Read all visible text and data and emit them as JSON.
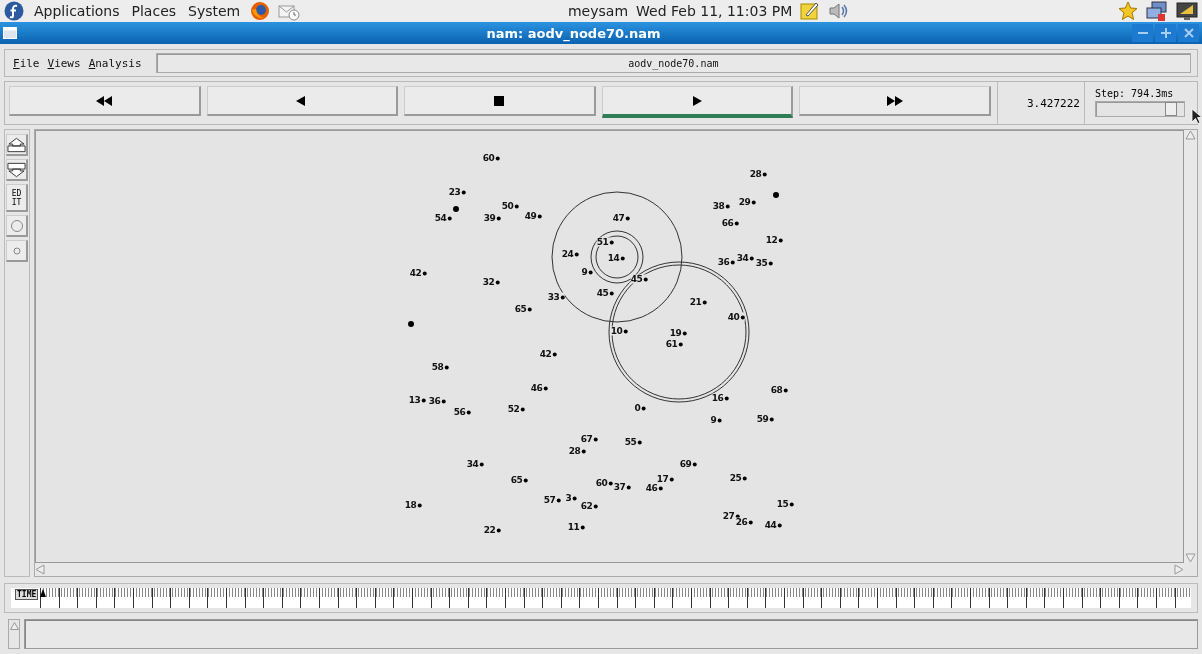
{
  "top_panel": {
    "menus": [
      "Applications",
      "Places",
      "System"
    ],
    "user": "meysam",
    "clock": "Wed Feb 11, 11:03 PM"
  },
  "window": {
    "title": "nam: aodv_node70.nam"
  },
  "menu_bar": {
    "items": [
      "File",
      "Views",
      "Analysis"
    ],
    "file_name": "aodv_node70.nam"
  },
  "playback": {
    "buttons": [
      {
        "kind": "rewind",
        "selected": false
      },
      {
        "kind": "back",
        "selected": false
      },
      {
        "kind": "stop",
        "selected": false
      },
      {
        "kind": "play",
        "selected": true
      },
      {
        "kind": "forward",
        "selected": false
      }
    ],
    "time": "3.427222",
    "step": {
      "label": "Step: 794.3ms",
      "level": 0.85
    }
  },
  "tools": [
    {
      "kind": "zoom-in"
    },
    {
      "kind": "zoom-out"
    },
    {
      "kind": "edit",
      "lines": [
        "ED",
        "IT"
      ]
    },
    {
      "kind": "large-circle"
    },
    {
      "kind": "small-circle"
    }
  ],
  "nodes": [
    {
      "kind": "labeled",
      "label": "60"
    },
    {
      "kind": "labeled",
      "label": "28"
    },
    {
      "kind": "labeled",
      "label": "23"
    },
    {
      "kind": "dot"
    },
    {
      "kind": "dot"
    },
    {
      "kind": "labeled",
      "label": "50"
    },
    {
      "kind": "labeled",
      "label": "38"
    },
    {
      "kind": "labeled",
      "label": "29"
    },
    {
      "kind": "labeled",
      "label": "54"
    },
    {
      "kind": "labeled",
      "label": "39"
    },
    {
      "kind": "labeled",
      "label": "49"
    },
    {
      "kind": "labeled",
      "label": "47"
    },
    {
      "kind": "labeled",
      "label": "66"
    },
    {
      "kind": "labeled",
      "label": "51"
    },
    {
      "kind": "labeled",
      "label": "12"
    },
    {
      "kind": "labeled",
      "label": "24"
    },
    {
      "kind": "labeled",
      "label": "14"
    },
    {
      "kind": "labeled",
      "label": "36"
    },
    {
      "kind": "labeled",
      "label": "34"
    },
    {
      "kind": "labeled",
      "label": "35"
    },
    {
      "kind": "labeled",
      "label": "42"
    },
    {
      "kind": "labeled",
      "label": "9"
    },
    {
      "kind": "labeled",
      "label": "32"
    },
    {
      "kind": "labeled",
      "label": "45"
    },
    {
      "kind": "labeled",
      "label": "33"
    },
    {
      "kind": "labeled",
      "label": "45"
    },
    {
      "kind": "labeled",
      "label": "65"
    },
    {
      "kind": "labeled",
      "label": "21"
    },
    {
      "kind": "labeled",
      "label": "40"
    },
    {
      "kind": "dot"
    },
    {
      "kind": "labeled",
      "label": "10"
    },
    {
      "kind": "labeled",
      "label": "19"
    },
    {
      "kind": "labeled",
      "label": "61"
    },
    {
      "kind": "labeled",
      "label": "42"
    },
    {
      "kind": "labeled",
      "label": "58"
    },
    {
      "kind": "labeled",
      "label": "46"
    },
    {
      "kind": "labeled",
      "label": "68"
    },
    {
      "kind": "labeled",
      "label": "13"
    },
    {
      "kind": "labeled",
      "label": "36"
    },
    {
      "kind": "labeled",
      "label": "16"
    },
    {
      "kind": "labeled",
      "label": "56"
    },
    {
      "kind": "labeled",
      "label": "52"
    },
    {
      "kind": "labeled",
      "label": "0"
    },
    {
      "kind": "labeled",
      "label": "9"
    },
    {
      "kind": "labeled",
      "label": "59"
    },
    {
      "kind": "labeled",
      "label": "67"
    },
    {
      "kind": "labeled",
      "label": "28"
    },
    {
      "kind": "labeled",
      "label": "55"
    },
    {
      "kind": "labeled",
      "label": "34"
    },
    {
      "kind": "labeled",
      "label": "69"
    },
    {
      "kind": "labeled",
      "label": "65"
    },
    {
      "kind": "labeled",
      "label": "60"
    },
    {
      "kind": "labeled",
      "label": "37"
    },
    {
      "kind": "labeled",
      "label": "46"
    },
    {
      "kind": "labeled",
      "label": "17"
    },
    {
      "kind": "labeled",
      "label": "25"
    },
    {
      "kind": "labeled",
      "label": "18"
    },
    {
      "kind": "labeled",
      "label": "57"
    },
    {
      "kind": "labeled",
      "label": "3"
    },
    {
      "kind": "labeled",
      "label": "62"
    },
    {
      "kind": "labeled",
      "label": "15"
    },
    {
      "kind": "labeled",
      "label": "27"
    },
    {
      "kind": "labeled",
      "label": "22"
    },
    {
      "kind": "labeled",
      "label": "11"
    },
    {
      "kind": "labeled",
      "label": "26"
    },
    {
      "kind": "labeled",
      "label": "44"
    }
  ],
  "timeline": {
    "label": "TIME",
    "level": 0
  }
}
